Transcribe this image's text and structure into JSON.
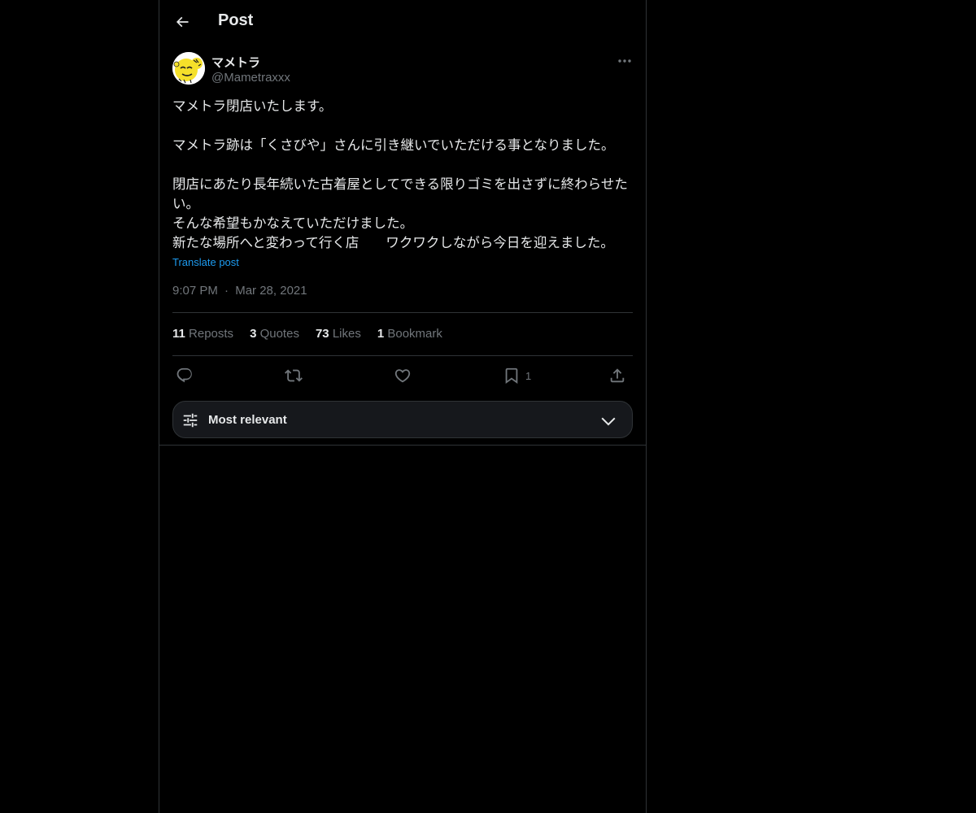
{
  "header": {
    "title": "Post",
    "back_icon": "arrow-left-icon"
  },
  "author": {
    "display_name": "マメトラ",
    "handle": "@Mametraxxx",
    "avatar_icon": "avatar-illustration"
  },
  "post": {
    "text": "マメトラ閉店いたします。\n\nマメトラ跡は「くさびや」さんに引き継いでいただける事となりました。\n\n閉店にあたり長年続いた古着屋としてできる限りゴミを出さずに終わらせたい。\nそんな希望もかなえていただけました。\n新たな場所へと変わって行く店　　ワクワクしながら今日を迎えました。",
    "translate_label": "Translate post",
    "time": "9:07 PM",
    "separator": "·",
    "date": "Mar 28, 2021"
  },
  "stats": {
    "reposts_count": "11",
    "reposts_label": "Reposts",
    "quotes_count": "3",
    "quotes_label": "Quotes",
    "likes_count": "73",
    "likes_label": "Likes",
    "bookmarks_count": "1",
    "bookmarks_label": "Bookmark"
  },
  "actions": {
    "reply_icon": "reply-icon",
    "repost_icon": "repost-icon",
    "like_icon": "heart-icon",
    "bookmark_icon": "bookmark-icon",
    "bookmark_count": "1",
    "share_icon": "share-icon"
  },
  "sort": {
    "label": "Most relevant"
  },
  "colors": {
    "background": "#000000",
    "text_primary": "#e7e9ea",
    "text_secondary": "#71767b",
    "link": "#1d9bf0",
    "border": "#2f3336"
  }
}
